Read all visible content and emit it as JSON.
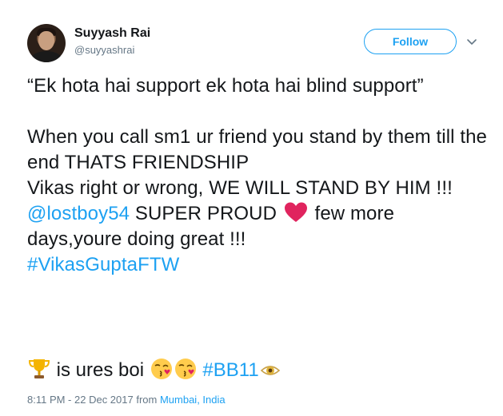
{
  "user": {
    "name": "Suyyash Rai",
    "handle": "@suyyashrai",
    "follow_label": "Follow"
  },
  "tweet": {
    "line1": "“Ek hota hai support ek hota hai blind support”",
    "line2": "When you call sm1 ur friend you stand by them till the end THATS FRIENDSHIP",
    "line3": "Vikas right or wrong, WE WILL STAND BY HIM !!!",
    "mention": "@lostboy54",
    "line4_after_mention": " SUPER PROUD ",
    "line4_tail": " few more days,youre doing great !!!",
    "hashtag1": "#VikasGuptaFTW",
    "emoji_text": " is ures boi ",
    "hashtag2": "#BB11"
  },
  "footer": {
    "timestamp": "8:11 PM - 22 Dec 2017 from ",
    "location": "Mumbai, India"
  },
  "colors": {
    "link": "#1da1f2",
    "text": "#14171a",
    "muted": "#657786",
    "heart": "#e0245e"
  },
  "icons": [
    "chevron-down-icon",
    "red-heart-icon",
    "trophy-icon",
    "kissing-face-icon",
    "eye-icon"
  ]
}
